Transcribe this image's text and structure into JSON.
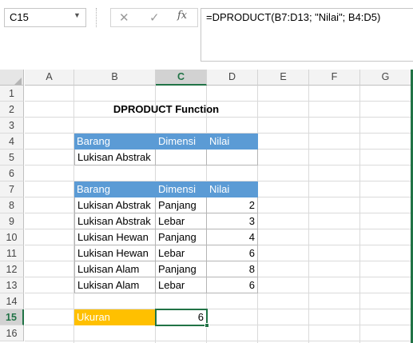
{
  "name_box": {
    "value": "C15",
    "dropdown_icon": "chevron-down-icon"
  },
  "formula_bar": {
    "cancel_icon": "cancel-x-icon",
    "enter_icon": "checkmark-icon",
    "fx_label": "fx",
    "formula": "=DPRODUCT(B7:D13; \"Nilai\"; B4:D5)"
  },
  "columns": [
    "A",
    "B",
    "C",
    "D",
    "E",
    "F",
    "G"
  ],
  "selected_column": "C",
  "rows": [
    "1",
    "2",
    "3",
    "4",
    "5",
    "6",
    "7",
    "8",
    "9",
    "10",
    "11",
    "12",
    "13",
    "14",
    "15",
    "16"
  ],
  "selected_row": "15",
  "title": "DPRODUCT Function",
  "criteria": {
    "headers": [
      "Barang",
      "Dimensi",
      "Nilai"
    ],
    "row": [
      "Lukisan Abstrak",
      "",
      ""
    ]
  },
  "database": {
    "headers": [
      "Barang",
      "Dimensi",
      "Nilai"
    ],
    "rows": [
      [
        "Lukisan Abstrak",
        "Panjang",
        "2"
      ],
      [
        "Lukisan Abstrak",
        "Lebar",
        "3"
      ],
      [
        "Lukisan Hewan",
        "Panjang",
        "4"
      ],
      [
        "Lukisan Hewan",
        "Lebar",
        "6"
      ],
      [
        "Lukisan Alam",
        "Panjang",
        "8"
      ],
      [
        "Lukisan Alam",
        "Lebar",
        "6"
      ]
    ]
  },
  "result": {
    "label": "Ukuran",
    "value": "6"
  },
  "colors": {
    "header_blue": "#5b9bd5",
    "result_orange": "#ffc000",
    "excel_green": "#217346"
  }
}
